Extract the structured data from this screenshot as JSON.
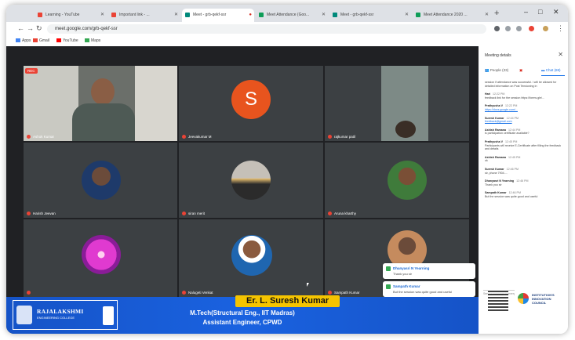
{
  "browser": {
    "tabs": [
      {
        "label": "Learning - YouTube",
        "color": "#ea4335"
      },
      {
        "label": "Important link - ...",
        "color": "#ea4335"
      },
      {
        "label": "Meet - grb-qekf-ssr",
        "color": "#00897b"
      },
      {
        "label": "Meet Attendance (Goo...",
        "color": "#0f9d58"
      },
      {
        "label": "Meet - grb-qekf-ssr",
        "color": "#00897b"
      },
      {
        "label": "Meet Attendance 2020 ...",
        "color": "#0f9d58"
      }
    ],
    "url": "meet.google.com/grb-qekf-ssr",
    "bookmarks": [
      "Apps",
      "Gmail",
      "YouTube",
      "Maps"
    ]
  },
  "meet": {
    "rec_label": "REC",
    "tiles": [
      {
        "name": "Ashok Kumar"
      },
      {
        "name": "Jeevakumar M",
        "initial": "S",
        "color": "#e8541e"
      },
      {
        "name": "rajkumar patil"
      },
      {
        "name": "Harish Jeevan"
      },
      {
        "name": "siran merit"
      },
      {
        "name": "Aruna kharthy"
      },
      {
        "name": ""
      },
      {
        "name": "Nalugeti Venkat"
      },
      {
        "name": "Sampath Kumar"
      }
    ]
  },
  "banner": {
    "college_name": "RAJALAKSHMI",
    "college_sub": "ENGINEERING COLLEGE",
    "speaker_name": "Er. L. Suresh Kumar",
    "line1": "M.Tech(Structural Eng., IIT Madras)",
    "line2": "Assistant Engineer, CPWD"
  },
  "panel": {
    "title": "Meeting details",
    "tabs": {
      "people": "People (33)",
      "chat": "Chat (69)"
    },
    "messages": [
      {
        "who": "",
        "time": "",
        "text": "session if attendance was successful. I will be allowed for detailed information on Post Tensioning in"
      },
      {
        "who": "Hari",
        "time": "12:22 PM",
        "text": "feedback link for the session https://forms.gle/..."
      },
      {
        "who": "Prathyusha V",
        "time": "12:22 PM",
        "link": "https://docs.google.com/..."
      },
      {
        "who": "Suresh Kumar",
        "time": "12:44 PM",
        "link": "feedback@gmail.com"
      },
      {
        "who": "Ashish Ramana",
        "time": "12:44 PM",
        "text": "is participation certificate available?"
      },
      {
        "who": "Prathyusha V",
        "time": "12:45 PM",
        "text": "Participants will receive E-Certificate after filling the feedback and details"
      },
      {
        "who": "Ashish Ramana",
        "time": "12:45 PM",
        "text": "ok"
      },
      {
        "who": "Suresh Kumar",
        "time": "12:46 PM",
        "text": "sir, phone 7904...."
      },
      {
        "who": "Dhanyasri N Yearning",
        "time": "12:46 PM",
        "text": "Thank you sir"
      },
      {
        "who": "Sampath Kumar",
        "time": "12:46 PM",
        "text": "But the session was quite good and useful"
      }
    ],
    "send_placeholder": "Send a message to everyone"
  },
  "toasts": [
    {
      "name": "Dhanyasri N Yearning",
      "text": "Thank you sir"
    },
    {
      "name": "Sampath Kumar",
      "text": "But the session was quite good and useful"
    }
  ],
  "footer_logo": {
    "text": "INSTITUTION'S INNOVATION COUNCIL"
  }
}
